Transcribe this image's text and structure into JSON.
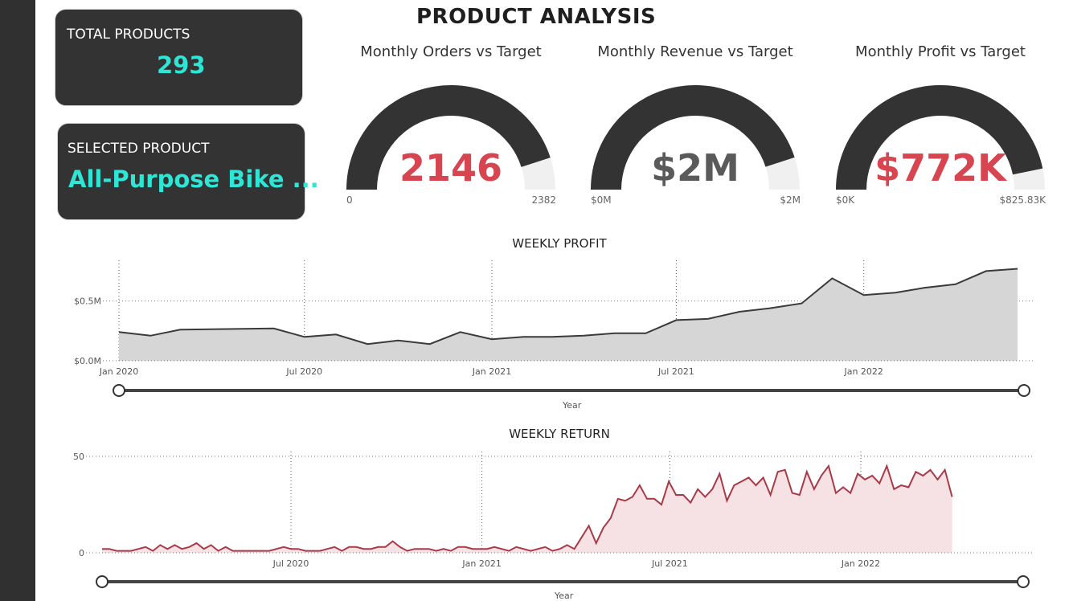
{
  "page": {
    "title": "PRODUCT ANALYSIS"
  },
  "cards": {
    "total_products": {
      "label": "TOTAL PRODUCTS",
      "value": "293"
    },
    "selected_product": {
      "label": "SELECTED PRODUCT",
      "value": "All-Purpose Bike ..."
    }
  },
  "colors": {
    "accent_teal": "#2ee6d6",
    "accent_red": "#d64550",
    "gauge_dark": "#333333",
    "gauge_bg": "#f0f0f0",
    "profit_fill": "#d6d6d6",
    "return_line": "#a83a47",
    "return_fill": "#f6e1e4"
  },
  "gauges": [
    {
      "title": "Monthly Orders vs Target",
      "value_label": "2146",
      "value": 2146,
      "min": 0,
      "max": 2382,
      "min_label": "0",
      "max_label": "2382",
      "value_color": "#d64550"
    },
    {
      "title": "Monthly Revenue vs Target",
      "value_label": "$2M",
      "value": 1.8,
      "min": 0,
      "max": 2,
      "min_label": "$0M",
      "max_label": "$2M",
      "value_color": "#5a5a5a"
    },
    {
      "title": "Monthly Profit vs Target",
      "value_label": "$772K",
      "value": 772,
      "min": 0,
      "max": 825.83,
      "min_label": "$0K",
      "max_label": "$825.83K",
      "value_color": "#d64550"
    }
  ],
  "chart_data": [
    {
      "type": "area",
      "title": "WEEKLY PROFIT",
      "xlabel": "Year",
      "ylabel": "",
      "x_ticks": [
        "Jan 2020",
        "Jul 2020",
        "Jan 2021",
        "Jul 2021",
        "Jan 2022"
      ],
      "y_ticks": [
        "$0.0M",
        "$0.5M"
      ],
      "ylim": [
        0,
        0.8
      ],
      "x_range": [
        "2020-01-01",
        "2022-06-08"
      ],
      "x": [
        "2020-01-01",
        "2020-02-01",
        "2020-03-01",
        "2020-06-01",
        "2020-07-01",
        "2020-08-01",
        "2020-09-01",
        "2020-10-01",
        "2020-11-01",
        "2020-12-01",
        "2021-01-01",
        "2021-02-01",
        "2021-03-01",
        "2021-04-01",
        "2021-05-01",
        "2021-06-01",
        "2021-07-01",
        "2021-08-01",
        "2021-09-01",
        "2021-10-01",
        "2021-11-01",
        "2021-12-01",
        "2022-01-01",
        "2022-02-01",
        "2022-03-01",
        "2022-04-01",
        "2022-05-01",
        "2022-06-01"
      ],
      "values": [
        0.24,
        0.21,
        0.26,
        0.27,
        0.2,
        0.22,
        0.14,
        0.17,
        0.14,
        0.24,
        0.18,
        0.2,
        0.2,
        0.21,
        0.23,
        0.23,
        0.34,
        0.35,
        0.41,
        0.44,
        0.48,
        0.69,
        0.55,
        0.57,
        0.61,
        0.64,
        0.75,
        0.77
      ],
      "grid": true
    },
    {
      "type": "area",
      "title": "WEEKLY RETURN",
      "xlabel": "Year",
      "ylabel": "",
      "x_ticks": [
        "Jul 2020",
        "Jan 2021",
        "Jul 2021",
        "Jan 2022"
      ],
      "y_ticks": [
        "0",
        "50"
      ],
      "ylim": [
        0,
        50
      ],
      "x_range": [
        "2020-01-01",
        "2022-06-08"
      ],
      "x_start": "2020-01-01",
      "x_step_days": 7,
      "values": [
        2,
        2,
        1,
        1,
        1,
        2,
        3,
        1,
        4,
        2,
        4,
        2,
        3,
        5,
        2,
        4,
        1,
        3,
        1,
        1,
        1,
        1,
        1,
        1,
        2,
        3,
        2,
        2,
        1,
        1,
        1,
        2,
        3,
        1,
        3,
        3,
        2,
        2,
        3,
        3,
        6,
        3,
        1,
        2,
        2,
        2,
        1,
        2,
        1,
        3,
        3,
        2,
        2,
        2,
        3,
        2,
        1,
        3,
        2,
        1,
        2,
        3,
        1,
        2,
        4,
        2,
        8,
        14,
        5,
        13,
        18,
        28,
        27,
        29,
        35,
        28,
        28,
        25,
        37,
        30,
        30,
        26,
        33,
        29,
        33,
        41,
        27,
        35,
        37,
        39,
        35,
        39,
        30,
        42,
        43,
        31,
        30,
        42,
        33,
        40,
        45,
        31,
        34,
        31,
        41,
        38,
        40,
        36,
        45,
        33,
        35,
        34,
        42,
        40,
        43,
        38,
        43,
        29
      ],
      "grid": true
    }
  ]
}
